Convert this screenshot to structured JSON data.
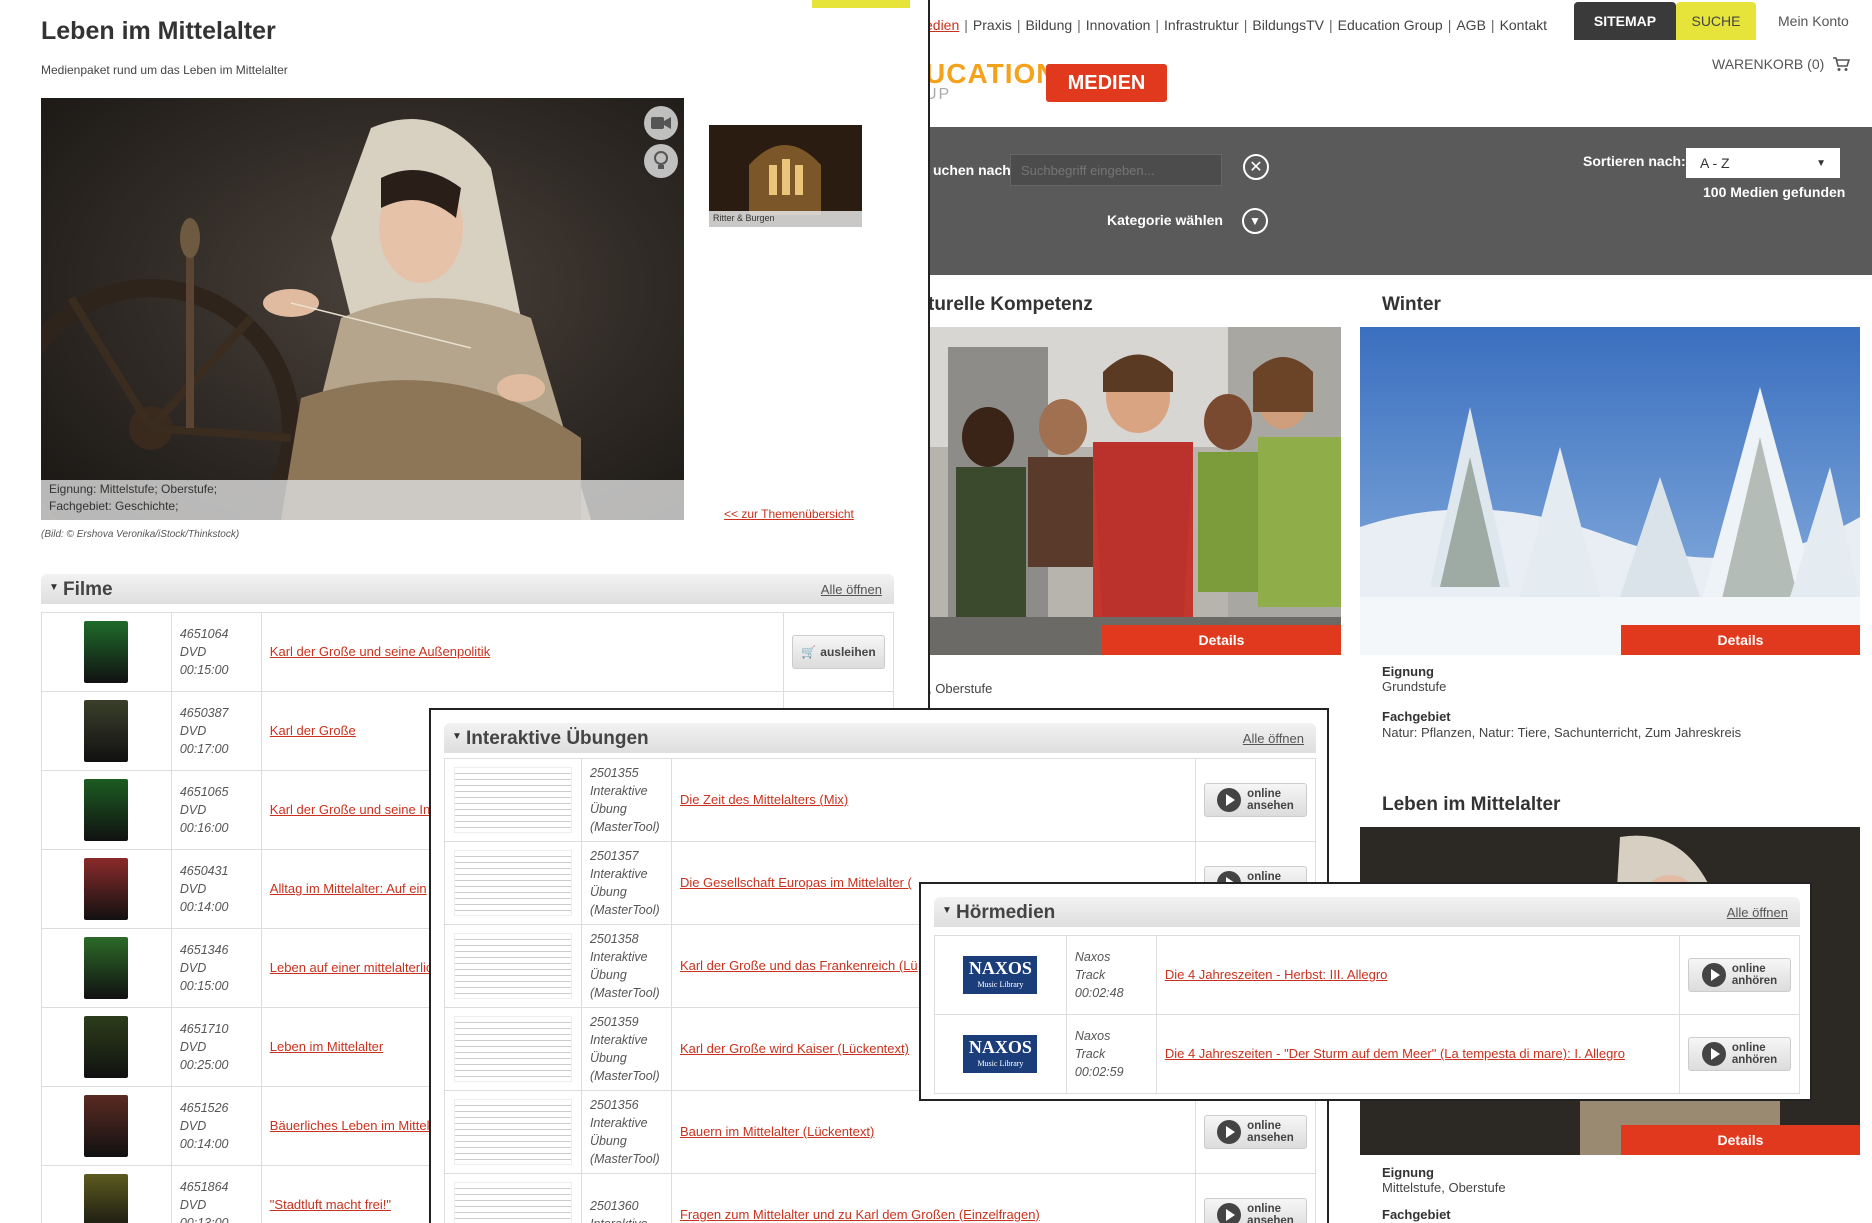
{
  "topnav": {
    "items": [
      "edien",
      "Praxis",
      "Bildung",
      "Innovation",
      "Infrastruktur",
      "BildungsTV",
      "Education Group",
      "AGB",
      "Kontakt"
    ],
    "sitemap": "SITEMAP",
    "suche": "SUCHE",
    "konto": "Mein Konto"
  },
  "header": {
    "logo_fragment": "UCATION",
    "logo_sub": "UP",
    "medien_badge": "MEDIEN",
    "cart": "WARENKORB (0)"
  },
  "search": {
    "label": "uchen nach",
    "placeholder": "Suchbegriff eingeben...",
    "category_label": "Kategorie wählen",
    "sort_label": "Sortieren nach:",
    "sort_value": "A - Z",
    "found": "100 Medien gefunden"
  },
  "cards": [
    {
      "title": "turelle Kompetenz",
      "details": "Details",
      "eignung_value": ", Oberstufe"
    },
    {
      "title": "Winter",
      "details": "Details",
      "eignung_label": "Eignung",
      "eignung_value": "Grundstufe",
      "fach_label": "Fachgebiet",
      "fach_value": "Natur: Pflanzen, Natur: Tiere, Sachunterricht, Zum Jahreskreis"
    },
    {
      "title": "Leben im Mittelalter",
      "details": "Details",
      "eignung_label": "Eignung",
      "eignung_value": "Mittelstufe, Oberstufe",
      "fach_label": "Fachgebiet"
    }
  ],
  "detail": {
    "title": "Leben im Mittelalter",
    "subtitle": "Medienpaket rund um das Leben im Mittelalter",
    "eignung": "Eignung: Mittelstufe; Oberstufe;",
    "fachgebiet": "Fachgebiet: Geschichte;",
    "credit": "(Bild: © Ershova Veronika/iStock/Thinkstock)",
    "related_caption": "Ritter & Burgen",
    "back_link": "<< zur Themenübersicht"
  },
  "filme": {
    "title": "Filme",
    "open_all": "Alle öffnen",
    "rows": [
      {
        "id": "4651064",
        "type": "DVD",
        "dur": "00:15:00",
        "title": "Karl der Große und seine Außenpolitik",
        "action": "ausleihen"
      },
      {
        "id": "4650387",
        "type": "DVD",
        "dur": "00:17:00",
        "title": "Karl der Große"
      },
      {
        "id": "4651065",
        "type": "DVD",
        "dur": "00:16:00",
        "title": "Karl der Große und seine In"
      },
      {
        "id": "4650431",
        "type": "DVD",
        "dur": "00:14:00",
        "title": "Alltag im Mittelalter: Auf ein"
      },
      {
        "id": "4651346",
        "type": "DVD",
        "dur": "00:15:00",
        "title": "Leben auf einer mittelalterlic"
      },
      {
        "id": "4651710",
        "type": "DVD",
        "dur": "00:25:00",
        "title": "Leben im Mittelalter"
      },
      {
        "id": "4651526",
        "type": "DVD",
        "dur": "00:14:00",
        "title": "Bäuerliches Leben im Mittel"
      },
      {
        "id": "4651864",
        "type": "DVD",
        "dur": "00:13:00",
        "title": "\"Stadtluft macht frei!\""
      }
    ]
  },
  "uebungen": {
    "title": "Interaktive Übungen",
    "open_all": "Alle öffnen",
    "action_l1": "online",
    "action_l2": "ansehen",
    "rows": [
      {
        "id": "2501355",
        "l1": "Interaktive",
        "l2": "Übung",
        "l3": "(MasterTool)",
        "title": "Die Zeit des Mittelalters (Mix)"
      },
      {
        "id": "2501357",
        "l1": "Interaktive",
        "l2": "Übung",
        "l3": "(MasterTool)",
        "title": "Die Gesellschaft Europas im Mittelalter ("
      },
      {
        "id": "2501358",
        "l1": "Interaktive",
        "l2": "Übung",
        "l3": "(MasterTool)",
        "title": "Karl der Große und das Frankenreich (Lü"
      },
      {
        "id": "2501359",
        "l1": "Interaktive",
        "l2": "Übung",
        "l3": "(MasterTool)",
        "title": "Karl der Große wird Kaiser (Lückentext)"
      },
      {
        "id": "2501356",
        "l1": "Interaktive",
        "l2": "Übung",
        "l3": "(MasterTool)",
        "title": "Bauern im Mittelalter (Lückentext)"
      },
      {
        "id": "2501360",
        "l1": "Interaktive",
        "l2": "",
        "l3": "",
        "title": "Fragen zum Mittelalter und zu Karl dem Großen (Einzelfragen)"
      }
    ]
  },
  "hoermedien": {
    "title": "Hörmedien",
    "open_all": "Alle öffnen",
    "action_l1": "online",
    "action_l2": "anhören",
    "logo_l1": "NAXOS",
    "logo_l2": "Music Library",
    "rows": [
      {
        "src": "Naxos",
        "type": "Track",
        "dur": "00:02:48",
        "title": "Die 4 Jahreszeiten - Herbst: III. Allegro"
      },
      {
        "src": "Naxos",
        "type": "Track",
        "dur": "00:02:59",
        "title": "Die 4 Jahreszeiten - \"Der Sturm auf dem Meer\" (La tempesta di mare): I. Allegro"
      }
    ]
  }
}
